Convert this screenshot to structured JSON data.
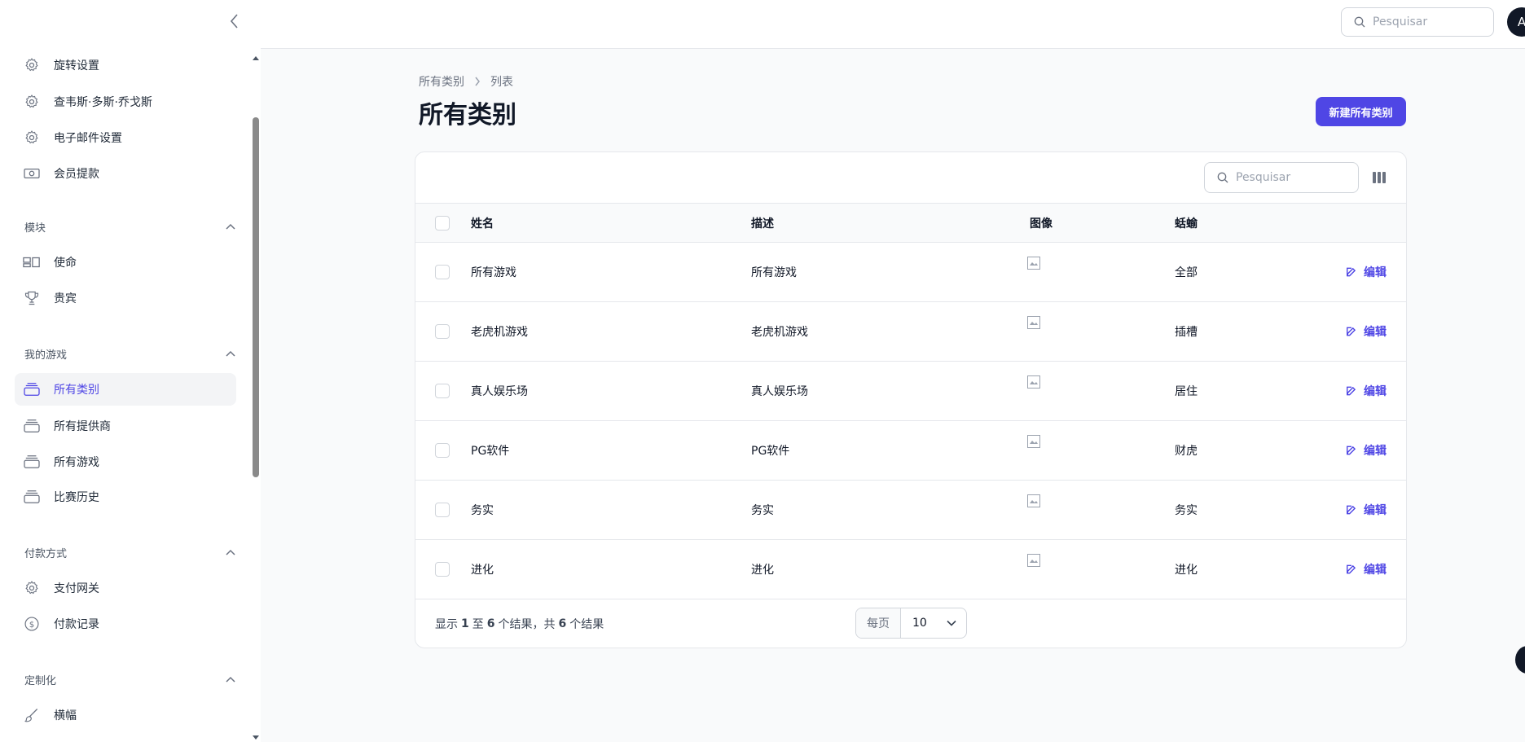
{
  "sidebar": {
    "items_top": [
      {
        "label": "旋转设置",
        "icon": "gear-icon"
      },
      {
        "label": "查韦斯·多斯·乔戈斯",
        "icon": "gear-icon"
      },
      {
        "label": "电子邮件设置",
        "icon": "gear-icon"
      },
      {
        "label": "会员提款",
        "icon": "banknote-icon"
      }
    ],
    "groups": [
      {
        "label": "模块",
        "items": [
          {
            "label": "使命",
            "icon": "layout-icon"
          },
          {
            "label": "贵宾",
            "icon": "trophy-icon"
          }
        ]
      },
      {
        "label": "我的游戏",
        "items": [
          {
            "label": "所有类别",
            "icon": "stack-icon",
            "active": true
          },
          {
            "label": "所有提供商",
            "icon": "stack-icon"
          },
          {
            "label": "所有游戏",
            "icon": "stack-icon"
          },
          {
            "label": "比赛历史",
            "icon": "stack-icon"
          }
        ]
      },
      {
        "label": "付款方式",
        "items": [
          {
            "label": "支付网关",
            "icon": "gear-icon"
          },
          {
            "label": "付款记录",
            "icon": "dollar-icon"
          }
        ]
      },
      {
        "label": "定制化",
        "items": [
          {
            "label": "横幅",
            "icon": "brush-icon"
          }
        ]
      }
    ]
  },
  "topbar": {
    "search_placeholder": "Pesquisar",
    "avatar_initial": "A"
  },
  "page": {
    "breadcrumb": [
      "所有类别",
      "列表"
    ],
    "title": "所有类别",
    "new_button": "新建所有类别"
  },
  "table": {
    "search_placeholder": "Pesquisar",
    "columns": [
      "姓名",
      "描述",
      "图像",
      "蛞蝓"
    ],
    "edit_label": "编辑",
    "rows": [
      {
        "name": "所有游戏",
        "description": "所有游戏",
        "slug": "全部"
      },
      {
        "name": "老虎机游戏",
        "description": "老虎机游戏",
        "slug": "插槽"
      },
      {
        "name": "真人娱乐场",
        "description": "真人娱乐场",
        "slug": "居住"
      },
      {
        "name": "PG软件",
        "description": "PG软件",
        "slug": "财虎"
      },
      {
        "name": "务实",
        "description": "务实",
        "slug": "务实"
      },
      {
        "name": "进化",
        "description": "进化",
        "slug": "进化"
      }
    ],
    "footer": {
      "prefix": "显示",
      "from": "1",
      "to_word": "至",
      "to": "6",
      "mid": "个结果，共",
      "total": "6",
      "suffix": "个结果",
      "per_page_label": "每页",
      "per_page_value": "10"
    }
  },
  "colors": {
    "accent": "#4f46e5",
    "sidebar_bg": "#ffffff",
    "page_bg": "#f9fafb"
  }
}
